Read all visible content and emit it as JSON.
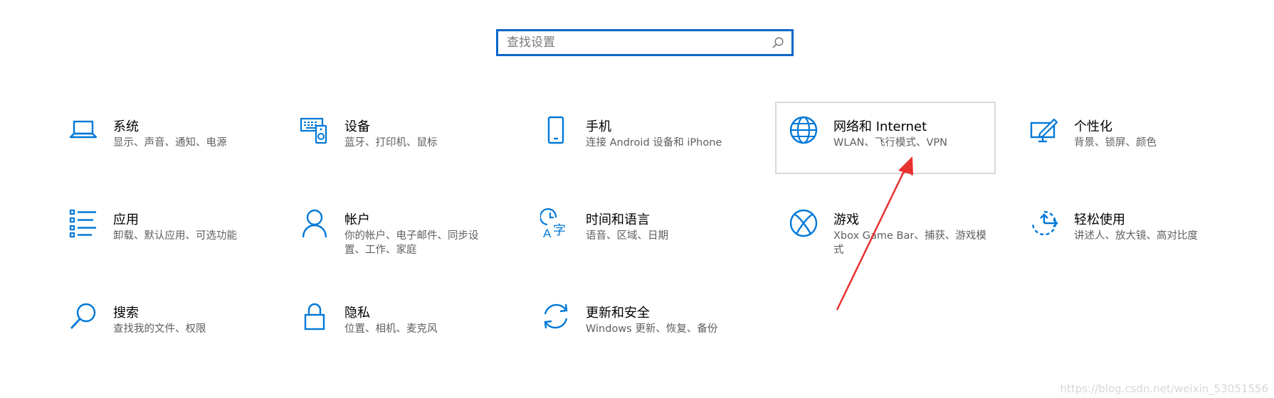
{
  "search": {
    "placeholder": "查找设置",
    "value": ""
  },
  "tiles": [
    {
      "id": "system",
      "title": "系统",
      "desc": "显示、声音、通知、电源",
      "icon": "laptop-icon"
    },
    {
      "id": "devices",
      "title": "设备",
      "desc": "蓝牙、打印机、鼠标",
      "icon": "keyboard-speaker-icon"
    },
    {
      "id": "phone",
      "title": "手机",
      "desc": "连接 Android 设备和 iPhone",
      "icon": "phone-icon"
    },
    {
      "id": "network",
      "title": "网络和 Internet",
      "desc": "WLAN、飞行模式、VPN",
      "icon": "globe-icon"
    },
    {
      "id": "personalization",
      "title": "个性化",
      "desc": "背景、锁屏、颜色",
      "icon": "paint-screen-icon"
    },
    {
      "id": "apps",
      "title": "应用",
      "desc": "卸载、默认应用、可选功能",
      "icon": "app-list-icon"
    },
    {
      "id": "accounts",
      "title": "帐户",
      "desc": "你的帐户、电子邮件、同步设置、工作、家庭",
      "icon": "person-icon"
    },
    {
      "id": "time-language",
      "title": "时间和语言",
      "desc": "语音、区域、日期",
      "icon": "clock-language-icon"
    },
    {
      "id": "gaming",
      "title": "游戏",
      "desc": "Xbox Game Bar、捕获、游戏模式",
      "icon": "xbox-icon"
    },
    {
      "id": "ease-of-access",
      "title": "轻松使用",
      "desc": "讲述人、放大镜、高对比度",
      "icon": "ease-of-access-icon"
    },
    {
      "id": "search",
      "title": "搜索",
      "desc": "查找我的文件、权限",
      "icon": "magnifier-icon"
    },
    {
      "id": "privacy",
      "title": "隐私",
      "desc": "位置、相机、麦克风",
      "icon": "lock-icon"
    },
    {
      "id": "update-security",
      "title": "更新和安全",
      "desc": "Windows 更新、恢复、备份",
      "icon": "sync-arrows-icon"
    }
  ],
  "hovered_tile": "network",
  "colors": {
    "accent": "#0a67c9",
    "icon": "#0078d7",
    "annotation": "#e8312f",
    "hover_border": "#d9d9d9"
  },
  "watermark": "https://blog.csdn.net/weixin_53051556"
}
